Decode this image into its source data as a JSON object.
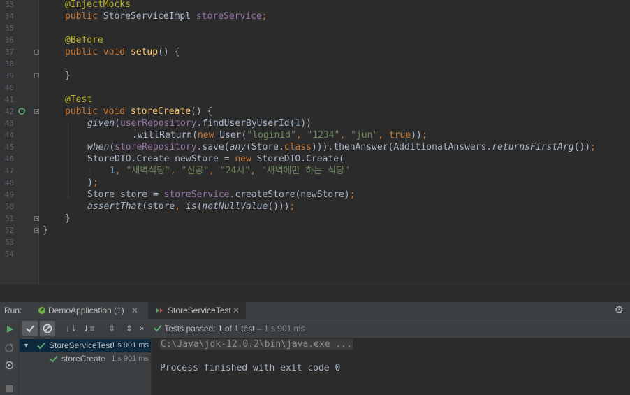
{
  "editor": {
    "line_numbers": [
      "33",
      "34",
      "35",
      "36",
      "37",
      "38",
      "39",
      "40",
      "41",
      "42",
      "43",
      "44",
      "45",
      "46",
      "47",
      "48",
      "49",
      "50",
      "51",
      "52",
      "53",
      "54"
    ]
  },
  "run_panel": {
    "run_label": "Run:",
    "tabs": [
      {
        "label": "DemoApplication (1)",
        "icon": "spring-boot-icon"
      },
      {
        "label": "StoreServiceTest",
        "icon": "junit-test-icon"
      }
    ],
    "status": {
      "prefix": "Tests passed:",
      "count": "1",
      "rest": "of 1 test",
      "time": "– 1 s 901 ms"
    },
    "tree": [
      {
        "label": "StoreServiceTest",
        "time": "1 s 901 ms"
      },
      {
        "label": "storeCreate",
        "time": "1 s 901 ms"
      }
    ],
    "console": {
      "command": "C:\\Java\\jdk-12.0.2\\bin\\java.exe ...",
      "exit": "Process finished with exit code 0"
    }
  },
  "colors": {
    "editor_bg": "#2b2b2b",
    "keyword": "#cc7832",
    "annotation": "#bbb529",
    "field": "#9876aa",
    "method": "#ffc66d",
    "string": "#6a8759",
    "number": "#6897bb",
    "pass_green": "#59a869"
  }
}
